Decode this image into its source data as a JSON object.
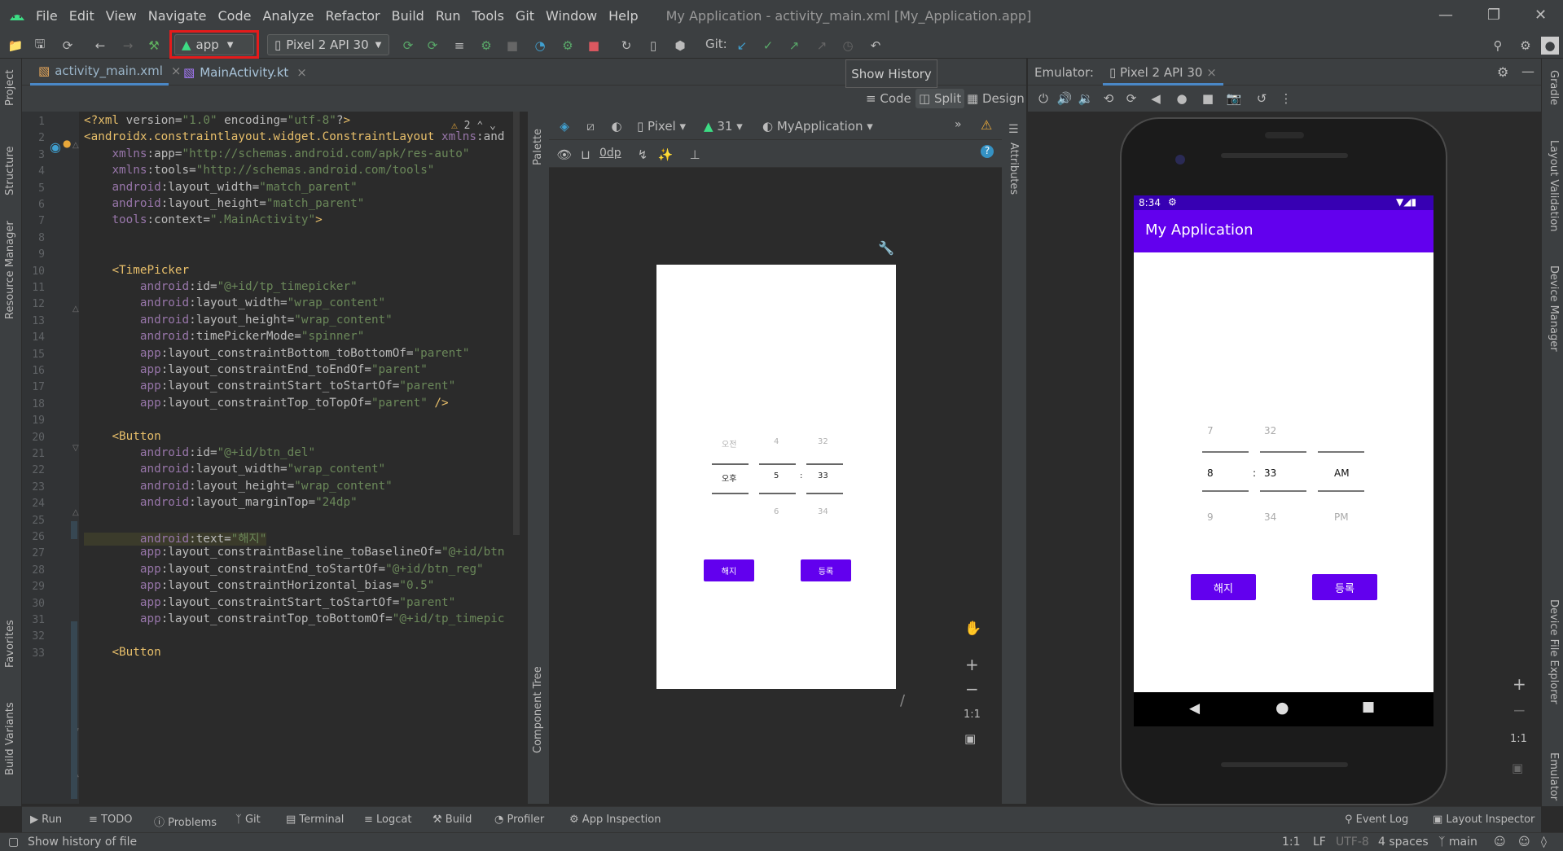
{
  "menu": {
    "items": [
      "File",
      "Edit",
      "View",
      "Navigate",
      "Code",
      "Analyze",
      "Refactor",
      "Build",
      "Run",
      "Tools",
      "Git",
      "Window",
      "Help"
    ],
    "window_title": "My Application - activity_main.xml [My_Application.app]"
  },
  "toolbar": {
    "run_config": "app",
    "device": "Pixel 2 API 30",
    "git_label": "Git:"
  },
  "tooltip": "Show History",
  "tabs": [
    {
      "label": "activity_main.xml"
    },
    {
      "label": "MainActivity.kt"
    }
  ],
  "view_modes": {
    "code": "Code",
    "split": "Split",
    "design": "Design"
  },
  "editor": {
    "warnings": "2",
    "lines": [
      "<?xml version=\"1.0\" encoding=\"utf-8\"?>",
      "<androidx.constraintlayout.widget.ConstraintLayout xmlns:and",
      "    xmlns:app=\"http://schemas.android.com/apk/res-auto\"",
      "    xmlns:tools=\"http://schemas.android.com/tools\"",
      "    android:layout_width=\"match_parent\"",
      "    android:layout_height=\"match_parent\"",
      "    tools:context=\".MainActivity\">",
      "",
      "",
      "    <TimePicker",
      "        android:id=\"@+id/tp_timepicker\"",
      "        android:layout_width=\"wrap_content\"",
      "        android:layout_height=\"wrap_content\"",
      "        android:timePickerMode=\"spinner\"",
      "        app:layout_constraintBottom_toBottomOf=\"parent\"",
      "        app:layout_constraintEnd_toEndOf=\"parent\"",
      "        app:layout_constraintStart_toStartOf=\"parent\"",
      "        app:layout_constraintTop_toTopOf=\"parent\" />",
      "",
      "    <Button",
      "        android:id=\"@+id/btn_del\"",
      "        android:layout_width=\"wrap_content\"",
      "        android:layout_height=\"wrap_content\"",
      "        android:layout_marginTop=\"24dp\"",
      "",
      "        android:text=\"해지\"",
      "        app:layout_constraintBaseline_toBaselineOf=\"@+id/btn",
      "        app:layout_constraintEnd_toStartOf=\"@+id/btn_reg\"",
      "        app:layout_constraintHorizontal_bias=\"0.5\"",
      "        app:layout_constraintStart_toStartOf=\"parent\"",
      "        app:layout_constraintTop_toBottomOf=\"@+id/tp_timepic",
      "",
      "    <Button"
    ]
  },
  "left_tools": [
    "Project",
    "Structure",
    "Resource Manager",
    "Favorites",
    "Build Variants"
  ],
  "right_tools": [
    "Gradle",
    "Layout Validation",
    "Device Manager",
    "Device File Explorer",
    "Emulator"
  ],
  "design": {
    "palette": "Palette",
    "component_tree": "Component Tree",
    "attributes": "Attributes",
    "device": "Pixel",
    "api": "31",
    "theme": "MyApplication",
    "dp": "0dp",
    "zoom_label": "1:1"
  },
  "preview": {
    "ampm_top": "오전",
    "hour_top": "4",
    "min_top": "32",
    "ampm_mid": "오후",
    "hour_mid": "5",
    "sep": ":",
    "min_mid": "33",
    "hour_bot": "6",
    "min_bot": "34",
    "btn_del": "해지",
    "btn_reg": "등록"
  },
  "emulator": {
    "label": "Emulator:",
    "device": "Pixel 2 API 30",
    "time": "8:34",
    "app_title": "My Application",
    "hour_top": "7",
    "min_top": "32",
    "hour_mid": "8",
    "sep": ":",
    "min_mid": "33",
    "ampm_mid": "AM",
    "hour_bot": "9",
    "min_bot": "34",
    "ampm_bot": "PM",
    "btn_del": "해지",
    "btn_reg": "등록",
    "zoom_label": "1:1"
  },
  "bottom_tabs": [
    "Run",
    "TODO",
    "Problems",
    "Git",
    "Terminal",
    "Logcat",
    "Build",
    "Profiler",
    "App Inspection"
  ],
  "bottom_right": [
    "Event Log",
    "Layout Inspector"
  ],
  "status": {
    "message": "Show history of file",
    "position": "1:1",
    "line_sep": "LF",
    "encoding": "UTF-8",
    "indent": "4 spaces",
    "branch": "main"
  },
  "colors": {
    "accent": "#6200ee",
    "status_bar": "#3700b3",
    "android_green": "#3ddc84",
    "highlight_red": "#e41b1b"
  }
}
